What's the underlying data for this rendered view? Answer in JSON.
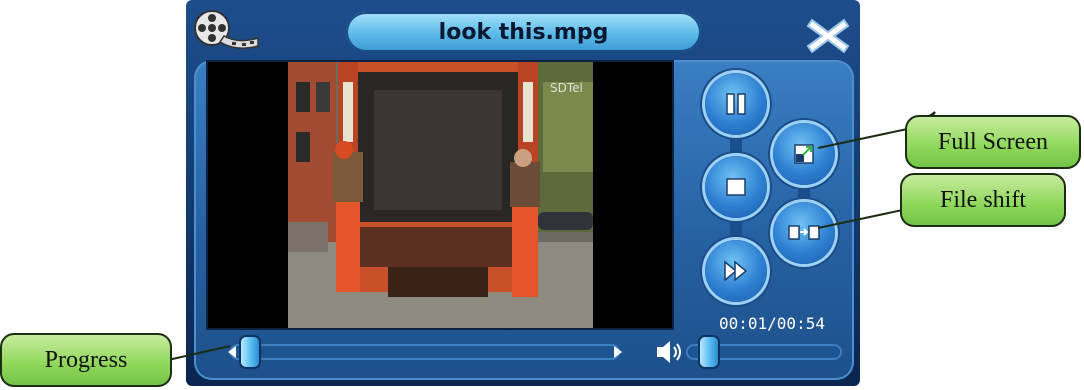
{
  "player": {
    "file_title": "look this.mpg",
    "time_display": "00:01/00:54",
    "progress_fraction": 0.02,
    "volume_fraction": 0.1
  },
  "controls": {
    "icons": [
      "pause-icon",
      "stop-icon",
      "fast-forward-icon",
      "full-screen-icon",
      "file-shift-icon",
      "close-icon",
      "film-reel-icon",
      "speaker-icon"
    ]
  },
  "callouts": {
    "full_screen": "Full Screen",
    "file_shift": "File shift",
    "progress": "Progress"
  },
  "colors": {
    "frame_blue": "#1d4e8c",
    "button_blue": "#2d7fd1",
    "callout_green": "#8ed75a"
  }
}
